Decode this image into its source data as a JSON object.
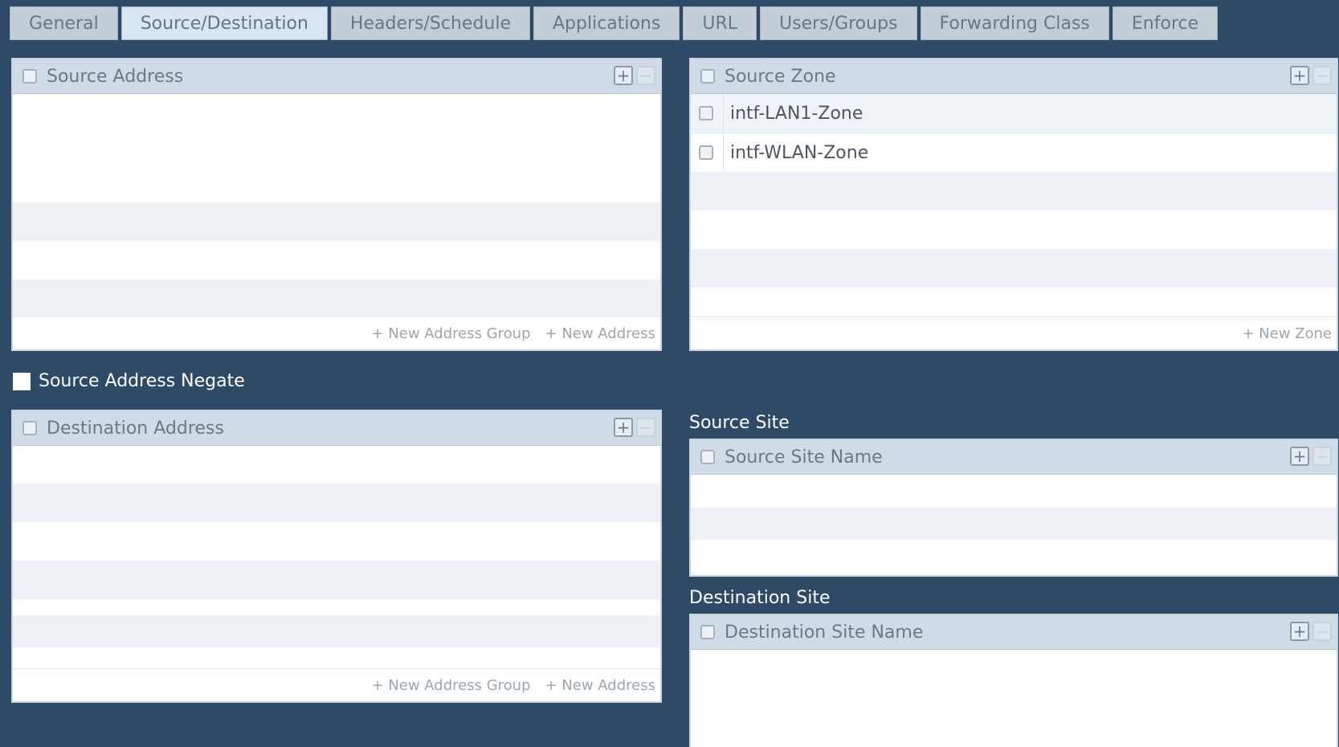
{
  "tabs": [
    {
      "label": "General"
    },
    {
      "label": "Source/Destination"
    },
    {
      "label": "Headers/Schedule"
    },
    {
      "label": "Applications"
    },
    {
      "label": "URL"
    },
    {
      "label": "Users/Groups"
    },
    {
      "label": "Forwarding Class"
    },
    {
      "label": "Enforce"
    }
  ],
  "active_tab": "Source/Destination",
  "source_address": {
    "title": "Source Address",
    "new_group": "+ New Address Group",
    "new_address": "+ New Address"
  },
  "source_zone": {
    "title": "Source Zone",
    "rows": [
      {
        "name": "intf-LAN1-Zone"
      },
      {
        "name": "intf-WLAN-Zone"
      }
    ],
    "new_zone": "+ New Zone"
  },
  "source_negate": {
    "label": "Source Address Negate"
  },
  "destination_address": {
    "title": "Destination Address",
    "new_group": "+ New Address Group",
    "new_address": "+ New Address"
  },
  "source_site": {
    "section": "Source Site",
    "title": "Source Site Name"
  },
  "destination_site": {
    "section": "Destination Site",
    "title": "Destination Site Name"
  },
  "icons": {
    "add": "plus-square-icon",
    "remove": "minus-square-icon"
  }
}
